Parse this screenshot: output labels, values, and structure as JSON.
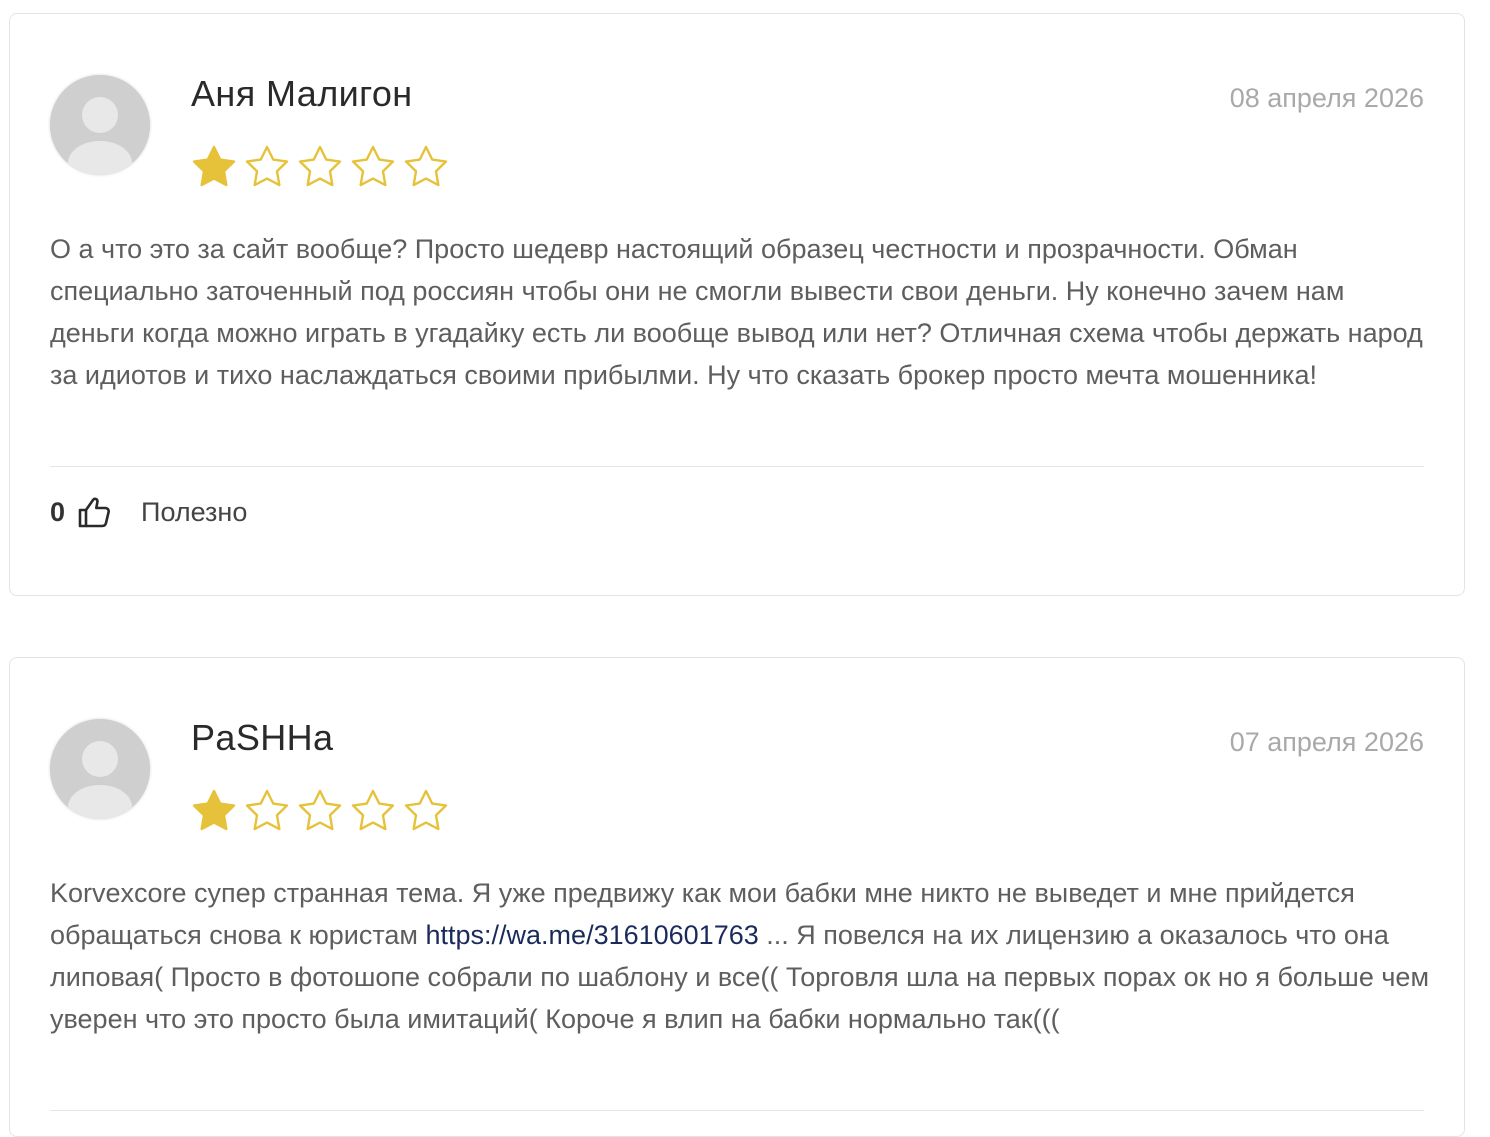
{
  "reviews": [
    {
      "author": "Аня Малигон",
      "date": "08 апреля 2026",
      "rating": 1,
      "rating_max": 5,
      "text": "О а что это за сайт вообще? Просто шедевр настоящий образец честности и прозрачности. Обман специально заточенный под россиян чтобы они не смогли вывести свои деньги. Ну конечно зачем нам деньги когда можно играть в угадайку есть ли вообще вывод или нет? Отличная схема чтобы держать народ за идиотов и тихо наслаждаться своими прибылми. Ну что сказать брокер просто мечта мошенника!",
      "helpful_count": "0",
      "helpful_label": "Полезно"
    },
    {
      "author": "PaSHHa",
      "date": "07 апреля 2026",
      "rating": 1,
      "rating_max": 5,
      "text_before_link": "Korvexcore супер странная тема. Я уже предвижу как мои бабки мне никто не выведет и мне прийдется обращаться снова к юристам ",
      "link": "https://wa.me/31610601763",
      "text_after_link": " ... Я повелся на их лицензию а оказалось что она липовая( Просто в фотошопе собрали по шаблону и все(( Торговля шла на первых порах ок но я больше чем уверен что это просто была имитаций( Короче я влип на бабки нормально так((("
    }
  ],
  "colors": {
    "star_filled": "#e6c23a",
    "star_outline": "#e6c23a",
    "date": "#a9a9a9",
    "link": "#1a2a5a"
  },
  "icons": {
    "avatar": "user-avatar-placeholder",
    "star_filled": "star-filled-icon",
    "star_empty": "star-outline-icon",
    "thumb": "thumbs-up-icon"
  }
}
